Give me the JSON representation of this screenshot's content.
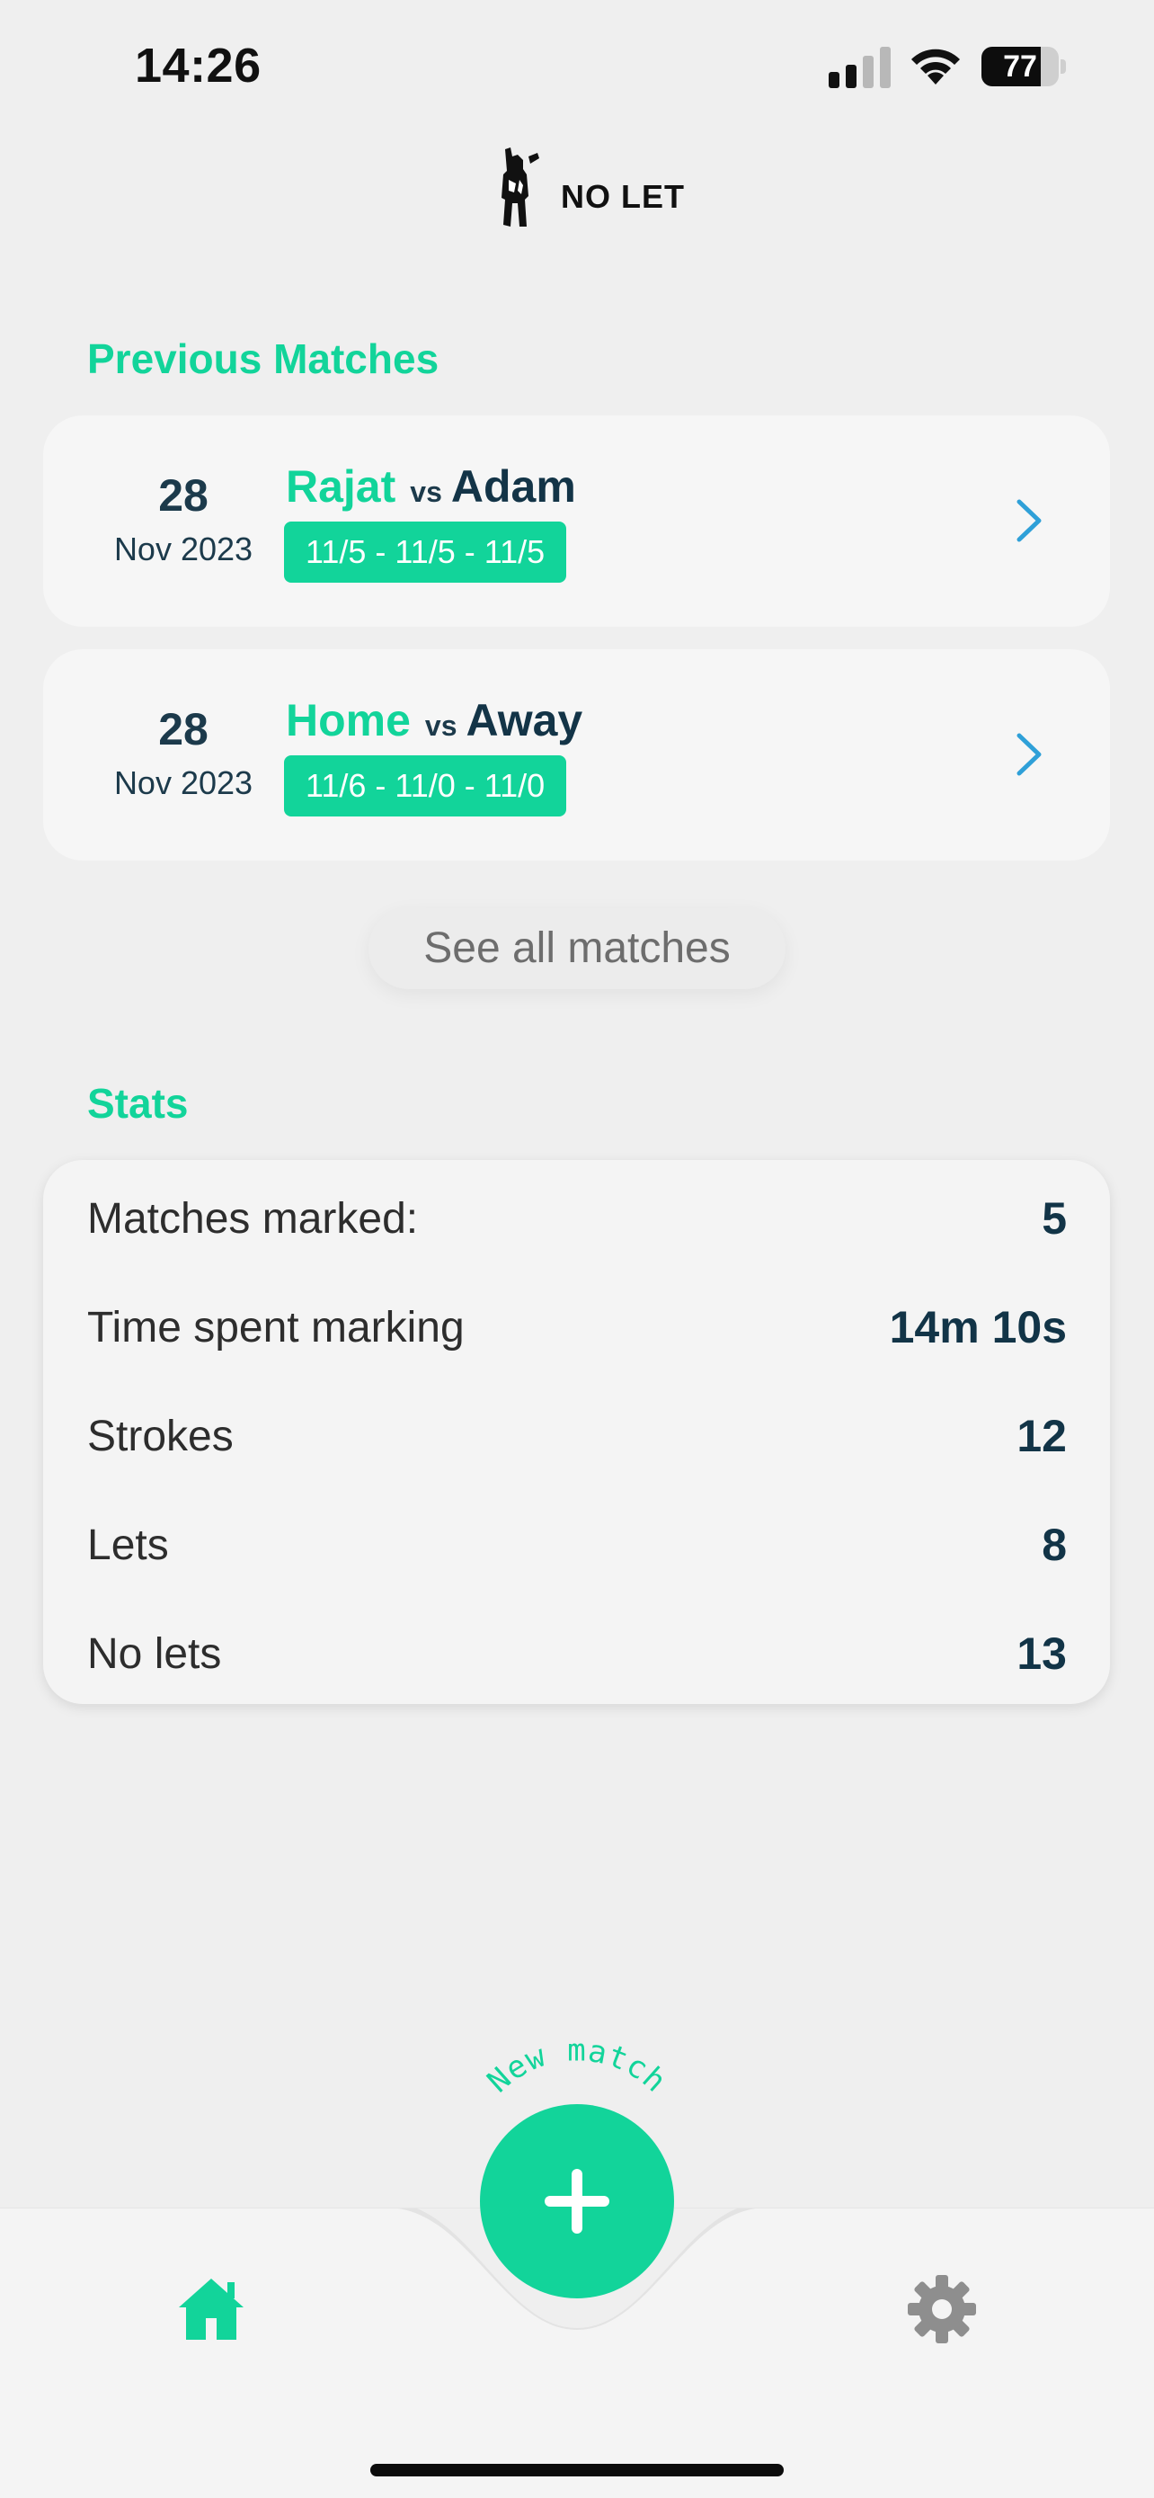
{
  "status_bar": {
    "time": "14:26",
    "battery": "77",
    "battery_level": 0.77
  },
  "header": {
    "title": "NO LET"
  },
  "previous_matches": {
    "title": "Previous Matches",
    "items": [
      {
        "day": "28",
        "month_year": "Nov 2023",
        "player_home": "Rajat",
        "vs": "vs",
        "player_away": "Adam",
        "score": "11/5 - 11/5 - 11/5"
      },
      {
        "day": "28",
        "month_year": "Nov 2023",
        "player_home": "Home",
        "vs": "vs",
        "player_away": "Away",
        "score": "11/6 - 11/0 - 11/0"
      }
    ],
    "see_all_label": "See all matches"
  },
  "stats": {
    "title": "Stats",
    "rows": [
      {
        "label": "Matches marked:",
        "value": "5"
      },
      {
        "label": "Time spent marking",
        "value": "14m 10s"
      },
      {
        "label": "Strokes",
        "value": "12"
      },
      {
        "label": "Lets",
        "value": "8"
      },
      {
        "label": "No lets",
        "value": "13"
      }
    ]
  },
  "fab": {
    "label": "New match"
  },
  "tab_bar": {
    "items": [
      {
        "name": "home",
        "icon": "home-icon",
        "active": true
      },
      {
        "name": "settings",
        "icon": "gear-icon",
        "active": false
      }
    ]
  },
  "colors": {
    "accent": "#12d49a",
    "dark": "#133447",
    "background": "#efefef",
    "card": "#f6f6f6",
    "chevron": "#2fa0d8",
    "inactive_icon": "#8e8e8e"
  }
}
